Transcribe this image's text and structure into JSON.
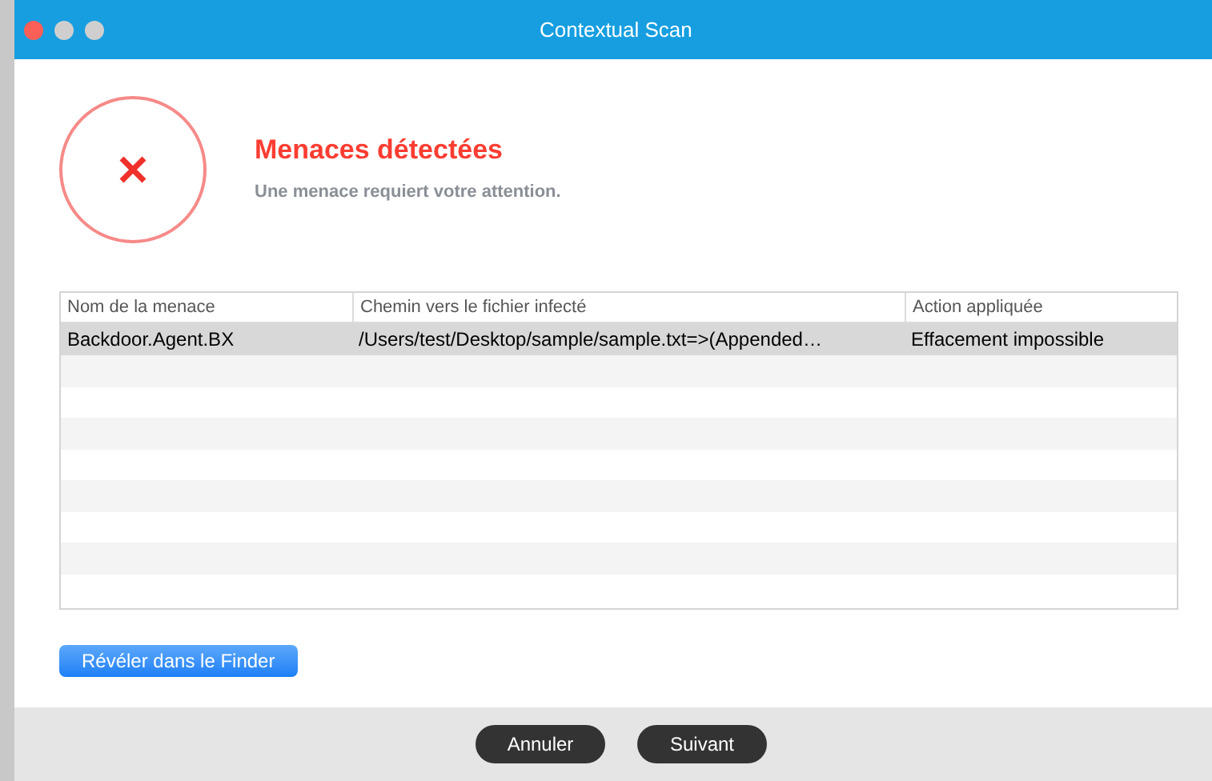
{
  "window": {
    "title": "Contextual Scan"
  },
  "header": {
    "title": "Menaces détectées",
    "subtitle": "Une menace requiert votre attention."
  },
  "table": {
    "columns": [
      "Nom de la menace",
      "Chemin vers le fichier infecté",
      "Action appliquée"
    ],
    "rows": [
      {
        "cells": [
          "Backdoor.Agent.BX",
          "/Users/test/Desktop/sample/sample.txt=>(Appended…",
          "Effacement impossible"
        ],
        "selected": true
      }
    ]
  },
  "reveal_button": "Révéler dans le Finder",
  "footer_buttons": [
    "Annuler",
    "Suivant"
  ]
}
